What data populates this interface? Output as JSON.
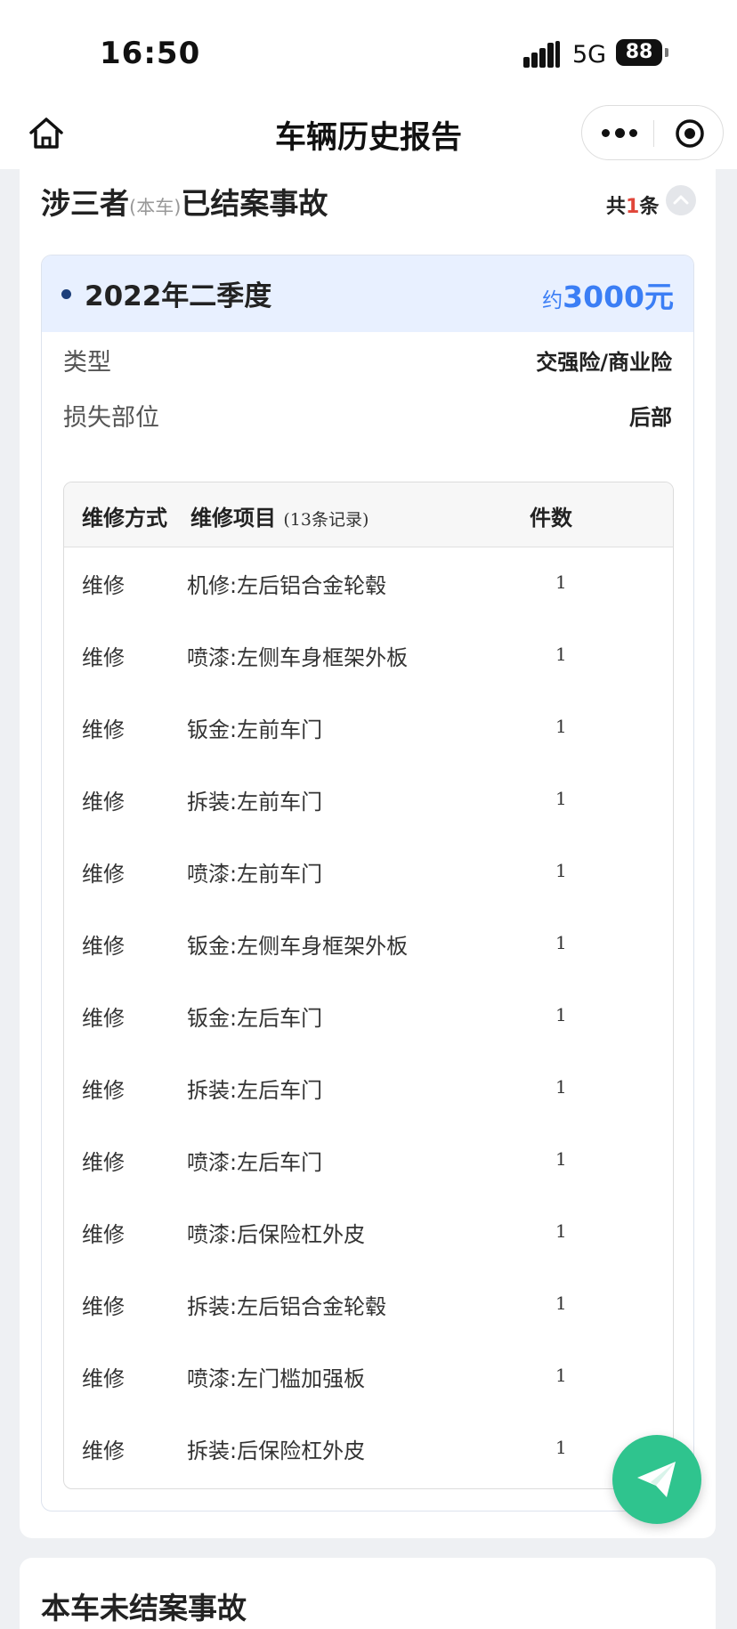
{
  "status_bar": {
    "time": "16:50",
    "network": "5G",
    "battery": "88"
  },
  "navbar": {
    "title": "车辆历史报告",
    "icons": {
      "home": "home-icon",
      "more": "more-icon",
      "close": "target-icon"
    }
  },
  "section": {
    "title_main": "涉三者",
    "title_note": "(本车)",
    "title_tail": "已结案事故",
    "count_prefix": "共",
    "count": "1",
    "count_suffix": "条"
  },
  "claim": {
    "quarter": "2022年二季度",
    "amount_prefix": "约",
    "amount": "3000元",
    "type_label": "类型",
    "type_value": "交强险/商业险",
    "part_label": "损失部位",
    "part_value": "后部"
  },
  "table": {
    "headers": {
      "method": "维修方式",
      "item": "维修项目",
      "item_note": "(13条记录)",
      "qty": "件数"
    },
    "rows": [
      {
        "method": "维修",
        "item": "机修:左后铝合金轮毂",
        "qty": "1"
      },
      {
        "method": "维修",
        "item": "喷漆:左侧车身框架外板",
        "qty": "1"
      },
      {
        "method": "维修",
        "item": "钣金:左前车门",
        "qty": "1"
      },
      {
        "method": "维修",
        "item": "拆装:左前车门",
        "qty": "1"
      },
      {
        "method": "维修",
        "item": "喷漆:左前车门",
        "qty": "1"
      },
      {
        "method": "维修",
        "item": "钣金:左侧车身框架外板",
        "qty": "1"
      },
      {
        "method": "维修",
        "item": "钣金:左后车门",
        "qty": "1"
      },
      {
        "method": "维修",
        "item": "拆装:左后车门",
        "qty": "1"
      },
      {
        "method": "维修",
        "item": "喷漆:左后车门",
        "qty": "1"
      },
      {
        "method": "维修",
        "item": "喷漆:后保险杠外皮",
        "qty": "1"
      },
      {
        "method": "维修",
        "item": "拆装:左后铝合金轮毂",
        "qty": "1"
      },
      {
        "method": "维修",
        "item": "喷漆:左门槛加强板",
        "qty": "1"
      },
      {
        "method": "维修",
        "item": "拆装:后保险杠外皮",
        "qty": "1"
      }
    ]
  },
  "next_section": {
    "title": "本车未结案事故"
  },
  "colors": {
    "accent": "#3b7ef5",
    "count_red": "#e0463a",
    "fab": "#2fc48e",
    "header_bg": "#e8f0ff"
  }
}
